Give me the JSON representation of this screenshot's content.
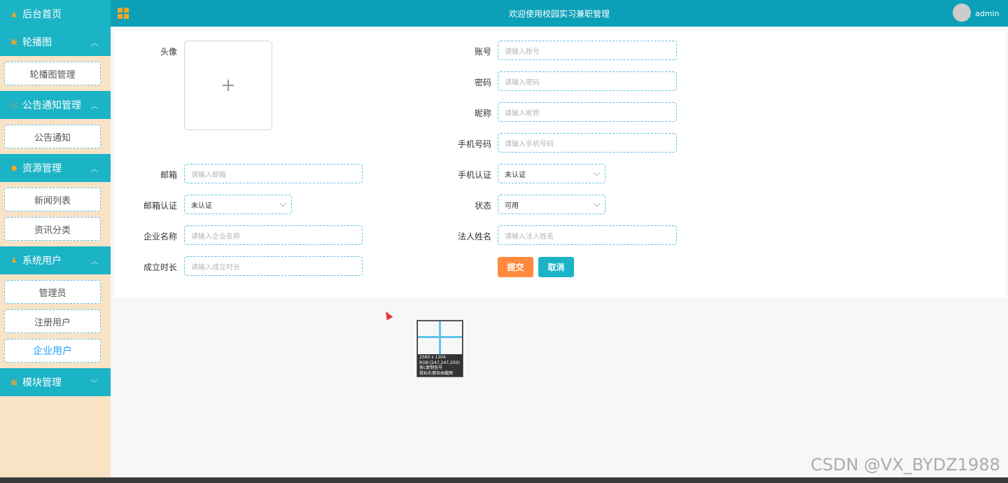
{
  "sidebar": {
    "home": "后台首页",
    "groups": [
      {
        "title": "轮播图",
        "items": [
          "轮播图管理"
        ]
      },
      {
        "title": "公告通知管理",
        "items": [
          "公告通知"
        ]
      },
      {
        "title": "资源管理",
        "items": [
          "新闻列表",
          "资讯分类"
        ]
      },
      {
        "title": "系统用户",
        "items": [
          "管理员",
          "注册用户",
          "企业用户"
        ]
      },
      {
        "title": "模块管理",
        "items": []
      }
    ]
  },
  "topbar": {
    "title": "欢迎使用校园实习兼职管理",
    "user": "admin"
  },
  "form": {
    "avatar_label": "头像",
    "upload_plus": "+",
    "account_label": "账号",
    "account_placeholder": "请输入账号",
    "password_label": "密码",
    "password_placeholder": "请输入密码",
    "nickname_label": "昵称",
    "nickname_placeholder": "请输入昵称",
    "phone_label": "手机号码",
    "phone_placeholder": "请输入手机号码",
    "email_label": "邮箱",
    "email_placeholder": "请输入邮箱",
    "phone_verify_label": "手机认证",
    "phone_verify_value": "未认证",
    "email_verify_label": "邮箱认证",
    "email_verify_value": "未认证",
    "status_label": "状态",
    "status_value": "可用",
    "company_label": "企业名称",
    "company_placeholder": "请输入企业名称",
    "legal_label": "法人姓名",
    "legal_placeholder": "请输入法人姓名",
    "duration_label": "成立时长",
    "duration_placeholder": "请输入成立时长",
    "submit": "提交",
    "cancel": "取消"
  },
  "picker": {
    "line1": "2560 x 1304",
    "line2": "RGB:(247,247,250)",
    "line3": "按c复制色号",
    "line4": "鼠标右键自由截图"
  },
  "watermark": "CSDN @VX_BYDZ1988"
}
